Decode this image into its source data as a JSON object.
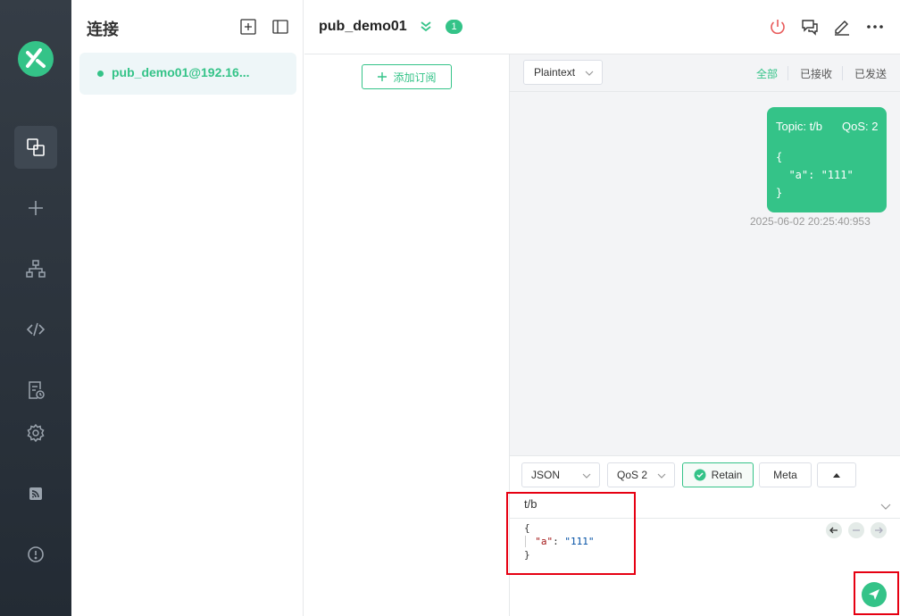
{
  "connections": {
    "title": "连接",
    "items": [
      {
        "name": "pub_demo01@192.16..."
      }
    ]
  },
  "header": {
    "title": "pub_demo01",
    "badge_count": "1"
  },
  "subscriptions": {
    "add_label": "添加订阅"
  },
  "messages": {
    "format": "Plaintext",
    "filters": {
      "all": "全部",
      "received": "已接收",
      "sent": "已发送"
    },
    "items": [
      {
        "topic": "Topic: t/b",
        "qos": "QoS: 2",
        "payload": "{\n  \"a\": \"111\"\n}",
        "time": "2025-06-02 20:25:40:953"
      }
    ]
  },
  "publish": {
    "payload_format": "JSON",
    "qos": "QoS 2",
    "retain_label": "Retain",
    "retain_checked": true,
    "meta_label": "Meta",
    "topic": "t/b",
    "payload": {
      "open": "{",
      "key": "\"a\"",
      "colon": ": ",
      "value": "\"111\"",
      "close": "}"
    }
  },
  "colors": {
    "accent": "#34c388",
    "rail": "#2b333c",
    "highlight": "#e60012"
  },
  "icons": [
    "logo-icon",
    "connections-icon",
    "plus-icon",
    "topology-icon",
    "code-icon",
    "log-icon",
    "settings-icon",
    "feed-icon",
    "info-icon",
    "new-connection-icon",
    "layout-icon",
    "double-chevron-icon",
    "power-icon",
    "chat-icon",
    "edit-icon",
    "more-icon",
    "send-icon"
  ]
}
